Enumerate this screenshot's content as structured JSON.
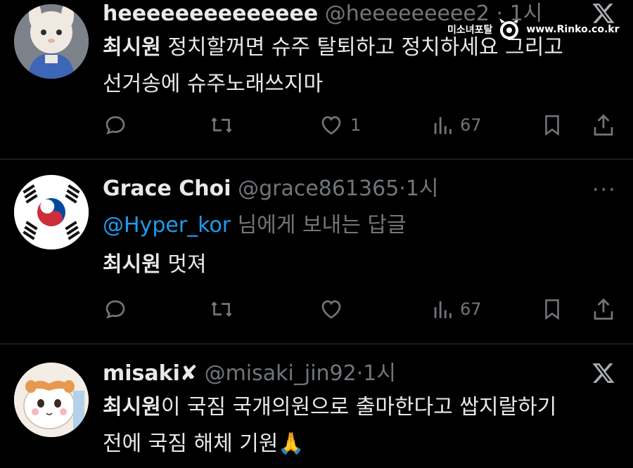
{
  "watermark": {
    "site_name": "미소녀포탈",
    "url": "www.Rinko.co.kr"
  },
  "tweets": [
    {
      "display_name": "heeeeeeeeeeeeee",
      "handle": "@heeeeeeeee2",
      "separator": "·",
      "time": "1시",
      "verified": false,
      "body_strong": "최시원",
      "body_line1": " 정치할꺼면 슈주 탈퇴하고 정치하세요 그리고",
      "body_line2": "선거송에 슈주노래쓰지마",
      "reply_count": "",
      "retweet_count": "",
      "like_count": "1",
      "view_count": "67",
      "avatar_icon": "plush-bunny-avatar",
      "menu_icon": "x-logo-icon"
    },
    {
      "display_name": "Grace Choi",
      "handle": "@grace861365",
      "separator": "·",
      "time": "1시",
      "verified": false,
      "reply_to_mention": "@Hyper_kor",
      "reply_to_suffix": " 님에게 보내는 답글",
      "body_strong": "최시원",
      "body_rest": " 멋져",
      "reply_count": "",
      "retweet_count": "",
      "like_count": "",
      "view_count": "67",
      "avatar_icon": "korean-flag-avatar",
      "menu_icon": "more-options-icon",
      "more_label": "···"
    },
    {
      "display_name": "misaki",
      "name_suffix": "✘",
      "handle": "@misaki_jin92",
      "separator": "·",
      "time": "1시",
      "verified": false,
      "body_strong": "최시원",
      "body_line1": "이 국짐 국개의원으로 출마한다고 쌉지랄하기",
      "body_line2": "전에 국짐 해체 기원",
      "body_emoji": "🙏",
      "avatar_icon": "hamster-cartoon-avatar",
      "menu_icon": "x-logo-icon"
    }
  ],
  "colors": {
    "background": "#000000",
    "text": "#e7e9ea",
    "muted": "#71767b",
    "link": "#1d9bf0",
    "divider": "#2f3336"
  }
}
